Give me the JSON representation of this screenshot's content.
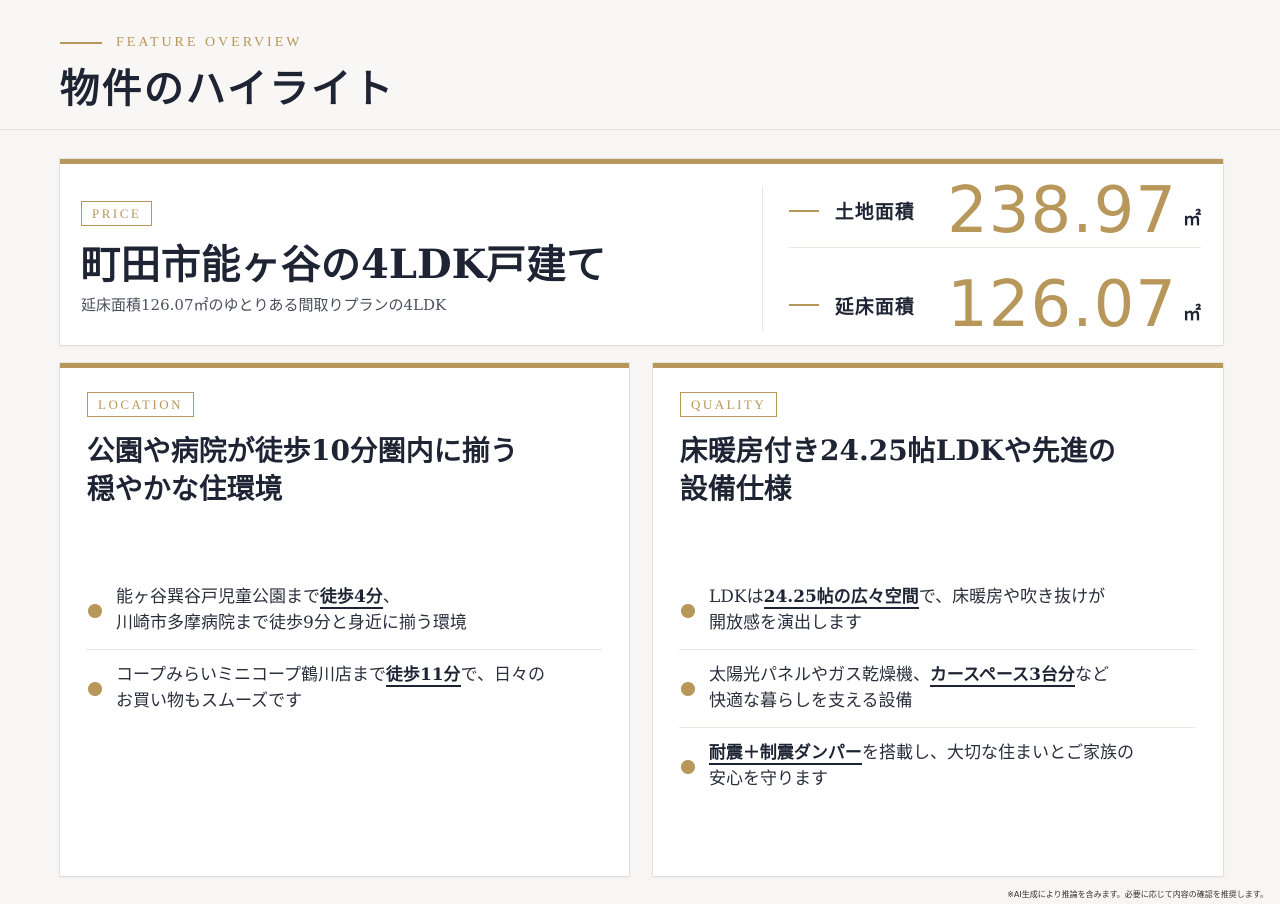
{
  "header": {
    "eyebrow": "FEATURE OVERVIEW",
    "title": "物件のハイライト"
  },
  "price": {
    "tag": "PRICE",
    "headline": "町田市能ヶ谷の4LDK戸建て",
    "sub": "延床面積126.07㎡のゆとりある間取りプランの4LDK",
    "stats": [
      {
        "label": "土地面積",
        "value": "238.97",
        "unit": "㎡"
      },
      {
        "label": "延床面積",
        "value": "126.07",
        "unit": "㎡"
      }
    ]
  },
  "location": {
    "tag": "LOCATION",
    "title_line1": "公園や病院が徒歩10分圏内に揃う",
    "title_line2": "穏やかな住環境",
    "items": [
      {
        "pre": "能ヶ谷巽谷戸児童公園まで",
        "highlight": "徒歩4分",
        "post": "、",
        "line2": "川崎市多摩病院まで徒歩9分と身近に揃う環境"
      },
      {
        "pre": "コープみらいミニコープ鶴川店まで",
        "highlight": "徒歩11分",
        "post": "で、日々の",
        "line2": "お買い物もスムーズです"
      }
    ]
  },
  "quality": {
    "tag": "QUALITY",
    "title_line1": "床暖房付き24.25帖LDKや先進の",
    "title_line2": "設備仕様",
    "items": [
      {
        "pre": "LDKは",
        "highlight": "24.25帖の広々空間",
        "post": "で、床暖房や吹き抜けが",
        "line2": "開放感を演出します"
      },
      {
        "pre": "太陽光パネルやガス乾燥機、",
        "highlight": "カースペース3台分",
        "post": "など",
        "line2": "快適な暮らしを支える設備"
      },
      {
        "pre": "",
        "highlight": "耐震＋制震ダンパー",
        "post": "を搭載し、大切な住まいとご家族の",
        "line2": "安心を守ります"
      }
    ]
  },
  "footnote": "※AI生成により推論を含みます。必要に応じて内容の確認を推奨します。",
  "colors": {
    "accent": "#b8975a",
    "text": "#1e2433",
    "background": "#f7f6f4"
  }
}
